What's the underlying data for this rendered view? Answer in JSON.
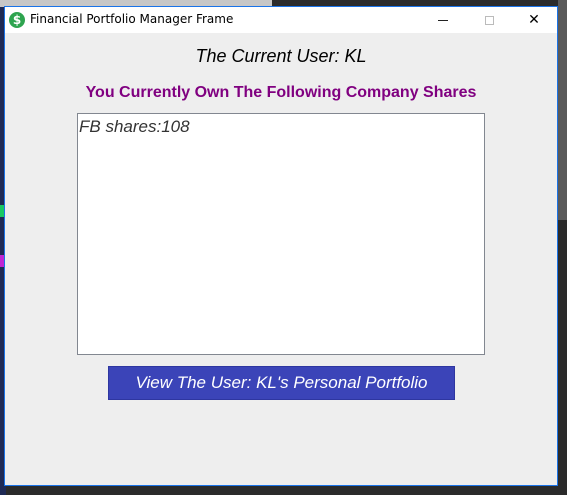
{
  "window": {
    "title": "Financial Portfolio Manager Frame",
    "icon": "dollar-icon",
    "icon_glyph": "$",
    "accent_color": "#1a73e8",
    "controls": {
      "minimize": "minimize-icon",
      "maximize": "maximize-icon",
      "close_glyph": "✕"
    }
  },
  "main": {
    "current_user_label": "The Current User: KL",
    "shares_heading": "You Currently Own The Following Company Shares",
    "shares_heading_color": "#800080",
    "shares": [
      "FB shares:108"
    ],
    "portfolio_button_label": "View The User: KL's Personal Portfolio",
    "portfolio_button_color": "#3b44b8"
  }
}
